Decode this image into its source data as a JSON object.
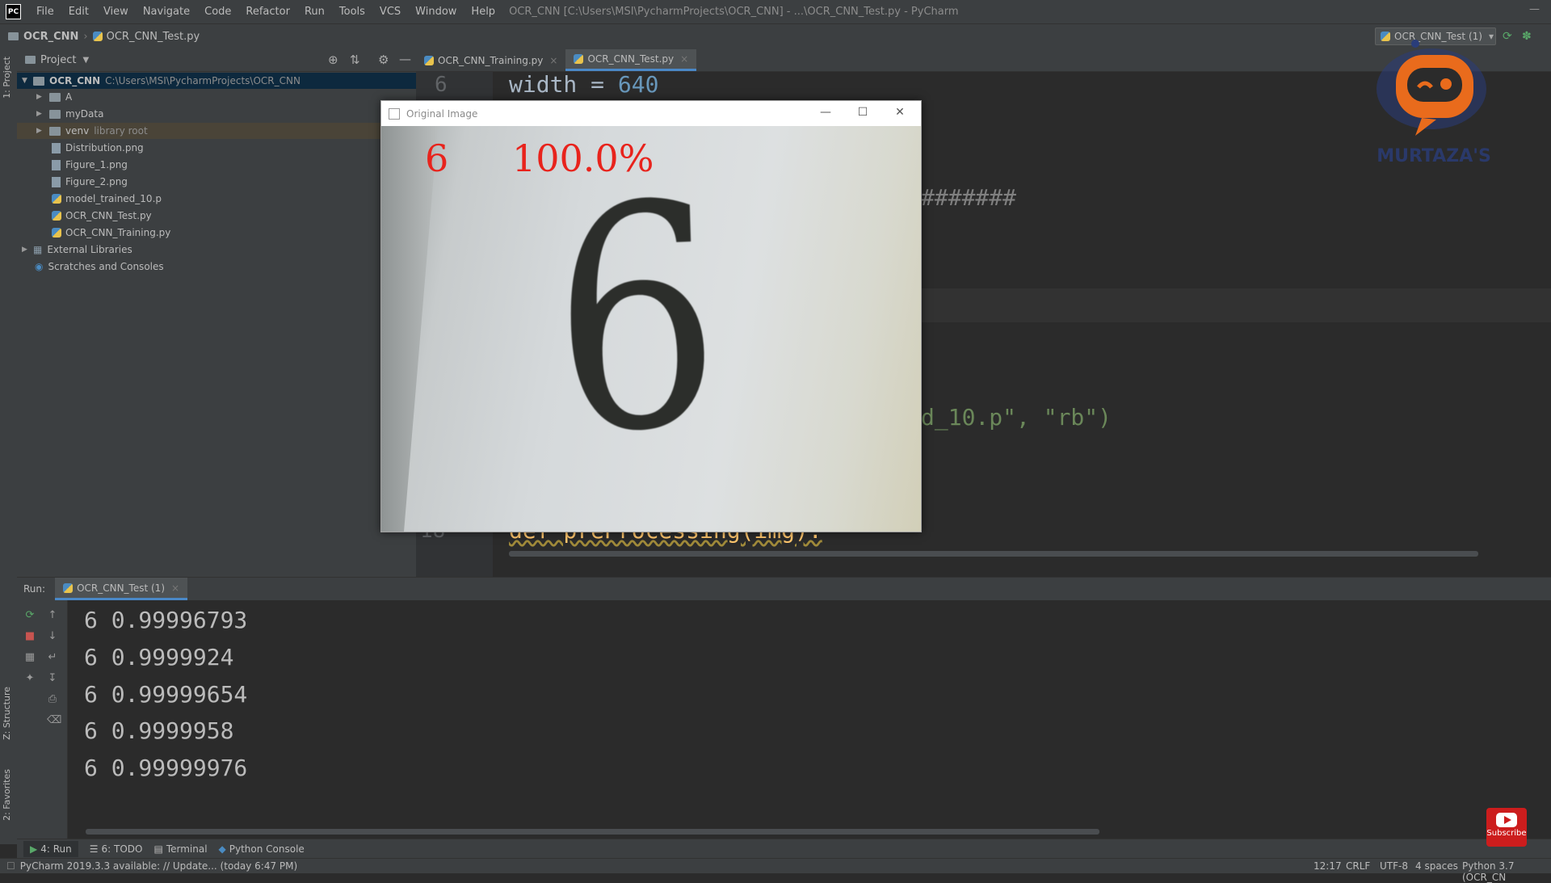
{
  "menubar": {
    "logo": "PC",
    "items": [
      "File",
      "Edit",
      "View",
      "Navigate",
      "Code",
      "Refactor",
      "Run",
      "Tools",
      "VCS",
      "Window",
      "Help"
    ],
    "title": "OCR_CNN [C:\\Users\\MSI\\PycharmProjects\\OCR_CNN] - ...\\OCR_CNN_Test.py - PyCharm"
  },
  "navbar": {
    "project": "OCR_CNN",
    "file": "OCR_CNN_Test.py",
    "run_config": "OCR_CNN_Test (1)"
  },
  "left_strip": {
    "project_tab": "1: Project",
    "structure_tab": "Z: Structure",
    "favorites_tab": "2: Favorites"
  },
  "project_panel": {
    "title": "Project",
    "root_name": "OCR_CNN",
    "root_path": "C:\\Users\\MSI\\PycharmProjects\\OCR_CNN",
    "items": [
      {
        "name": "A",
        "kind": "folder"
      },
      {
        "name": "myData",
        "kind": "folder"
      },
      {
        "name": "venv",
        "kind": "folder",
        "note": "library root"
      },
      {
        "name": "Distribution.png",
        "kind": "file"
      },
      {
        "name": "Figure_1.png",
        "kind": "file"
      },
      {
        "name": "Figure_2.png",
        "kind": "file"
      },
      {
        "name": "model_trained_10.p",
        "kind": "file"
      },
      {
        "name": "OCR_CNN_Test.py",
        "kind": "py"
      },
      {
        "name": "OCR_CNN_Training.py",
        "kind": "py"
      }
    ],
    "external_libraries": "External Libraries",
    "scratches": "Scratches and Consoles"
  },
  "editor": {
    "tabs": [
      {
        "label": "OCR_CNN_Training.py",
        "active": false
      },
      {
        "label": "OCR_CNN_Test.py",
        "active": true
      }
    ],
    "line6_num": "6",
    "line6_text": "width = ",
    "line6_value": "640",
    "hash_fragment": "#######",
    "pickle_fragment_a": "d_10.p\", ",
    "pickle_fragment_b": "\"rb\")",
    "line18_num": "18",
    "line18_text": "def preProcessing(img):"
  },
  "cv_window": {
    "title": "Original Image",
    "pred_class": "6",
    "pred_prob": "100.0%",
    "digit": "6"
  },
  "run_panel": {
    "label": "Run:",
    "tab": "OCR_CNN_Test (1)",
    "output": [
      "6 0.99996793",
      "6 0.9999924",
      "6 0.99999654",
      "6 0.9999958",
      "6 0.99999976"
    ]
  },
  "toolwindows": [
    "4: Run",
    "6: TODO",
    "Terminal",
    "Python Console"
  ],
  "status": {
    "message": "PyCharm 2019.3.3 available: // Update... (today 6:47 PM)",
    "position": "12:17",
    "line_sep": "CRLF",
    "encoding": "UTF-8",
    "indent": "4 spaces",
    "interpreter": "Python 3.7 (OCR_CN"
  },
  "overlay": {
    "logo_text": "MURTAZA'S",
    "subscribe": "Subscribe"
  }
}
